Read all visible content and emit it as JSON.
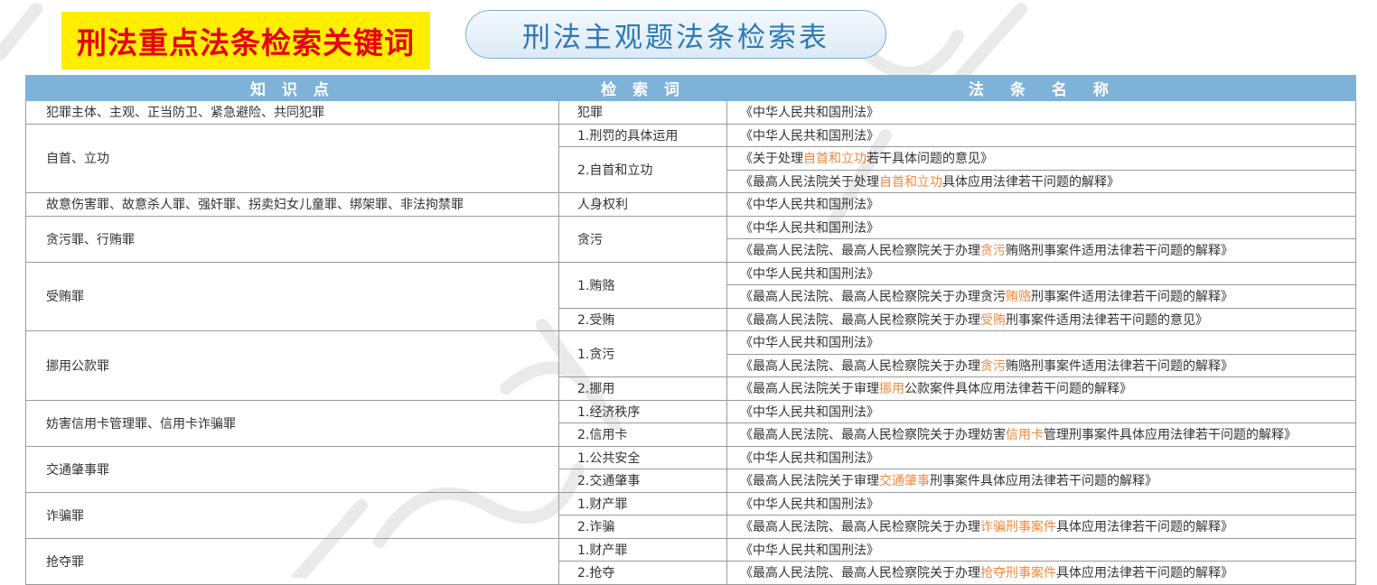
{
  "header": {
    "keyword_tag": "刑法重点法条检索关键词",
    "title": "刑法主观题法条检索表"
  },
  "table": {
    "headers": [
      "知 识 点",
      "检 索 词",
      "法　条　名　称"
    ],
    "groups": [
      {
        "topic": "犯罪主体、主观、正当防卫、紧急避险、共同犯罪",
        "keywords": [
          {
            "kw": "犯罪",
            "laws": [
              [
                "《中华人民共和国刑法》"
              ]
            ]
          }
        ]
      },
      {
        "topic": "自首、立功",
        "keywords": [
          {
            "kw": "1.刑罚的具体运用",
            "laws": [
              [
                "《中华人民共和国刑法》"
              ]
            ]
          },
          {
            "kw": "2.自首和立功",
            "laws": [
              [
                "《关于处理",
                "自首和立功",
                "若干具体问题的意见》"
              ],
              [
                "《最高人民法院关于处理",
                "自首和立功",
                "具体应用法律若干问题的解释》"
              ]
            ]
          }
        ]
      },
      {
        "topic": "故意伤害罪、故意杀人罪、强奸罪、拐卖妇女儿童罪、绑架罪、非法拘禁罪",
        "keywords": [
          {
            "kw": "人身权利",
            "laws": [
              [
                "《中华人民共和国刑法》"
              ]
            ]
          }
        ]
      },
      {
        "topic": "贪污罪、行贿罪",
        "keywords": [
          {
            "kw": "贪污",
            "laws": [
              [
                "《中华人民共和国刑法》"
              ],
              [
                "《最高人民法院、最高人民检察院关于办理",
                "贪污",
                "贿赂刑事案件适用法律若干问题的解释》"
              ]
            ]
          }
        ]
      },
      {
        "topic": "受贿罪",
        "keywords": [
          {
            "kw": "1.贿赂",
            "laws": [
              [
                "《中华人民共和国刑法》"
              ],
              [
                "《最高人民法院、最高人民检察院关于办理贪污",
                "贿赂",
                "刑事案件适用法律若干问题的解释》"
              ]
            ]
          },
          {
            "kw": "2.受贿",
            "laws": [
              [
                "《最高人民法院、最高人民检察院关于办理",
                "受贿",
                "刑事案件适用法律若干问题的意见》"
              ]
            ]
          }
        ]
      },
      {
        "topic": "挪用公款罪",
        "keywords": [
          {
            "kw": "1.贪污",
            "laws": [
              [
                "《中华人民共和国刑法》"
              ],
              [
                "《最高人民法院、最高人民检察院关于办理",
                "贪污",
                "贿赂刑事案件适用法律若干问题的解释》"
              ]
            ]
          },
          {
            "kw": "2.挪用",
            "laws": [
              [
                "《最高人民法院关于审理",
                "挪用",
                "公款案件具体应用法律若干问题的解释》"
              ]
            ]
          }
        ]
      },
      {
        "topic": "妨害信用卡管理罪、信用卡诈骗罪",
        "keywords": [
          {
            "kw": "1.经济秩序",
            "laws": [
              [
                "《中华人民共和国刑法》"
              ]
            ]
          },
          {
            "kw": "2.信用卡",
            "laws": [
              [
                "《最高人民法院、最高人民检察院关于办理妨害",
                "信用卡",
                "管理刑事案件具体应用法律若干问题的解释》"
              ]
            ]
          }
        ]
      },
      {
        "topic": "交通肇事罪",
        "keywords": [
          {
            "kw": "1.公共安全",
            "laws": [
              [
                "《中华人民共和国刑法》"
              ]
            ]
          },
          {
            "kw": "2.交通肇事",
            "laws": [
              [
                "《最高人民法院关于审理",
                "交通肇事",
                "刑事案件具体应用法律若干问题的解释》"
              ]
            ]
          }
        ]
      },
      {
        "topic": "诈骗罪",
        "keywords": [
          {
            "kw": "1.财产罪",
            "laws": [
              [
                "《中华人民共和国刑法》"
              ]
            ]
          },
          {
            "kw": "2.诈骗",
            "laws": [
              [
                "《最高人民法院、最高人民检察院关于办理",
                "诈骗刑事案件",
                "具体应用法律若干问题的解释》"
              ]
            ]
          }
        ]
      },
      {
        "topic": "抢夺罪",
        "keywords": [
          {
            "kw": "1.财产罪",
            "laws": [
              [
                "《中华人民共和国刑法》"
              ]
            ]
          },
          {
            "kw": "2.抢夺",
            "laws": [
              [
                "《最高人民法院、最高人民检察院关于办理",
                "抢夺刑事案件",
                "具体应用法律若干问题的解释》"
              ]
            ]
          }
        ]
      }
    ]
  },
  "colors": {
    "highlight": "#f0883c",
    "header_bg": "#7fb2d9",
    "tag_yellow": "#ffee00",
    "tag_red_text": "#e60012",
    "title_blue": "#2d79b8"
  }
}
